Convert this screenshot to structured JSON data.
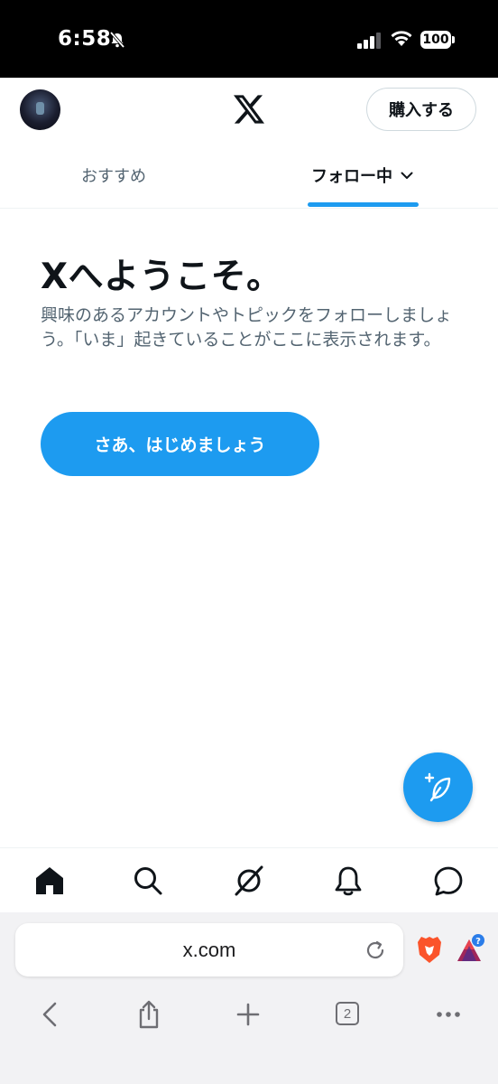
{
  "status_bar": {
    "time": "6:58",
    "battery": "100"
  },
  "header": {
    "logo": "x-logo",
    "subscribe_label": "購入する"
  },
  "tabs": [
    {
      "label": "おすすめ",
      "active": false
    },
    {
      "label": "フォロー中",
      "active": true
    }
  ],
  "welcome": {
    "title": "Xへようこそ。",
    "description": "興味のあるアカウントやトピックをフォローしましょう。「いま」起きていることがここに表示されます。",
    "button_label": "さあ、はじめましょう"
  },
  "bottom_nav": {
    "items": [
      "home-icon",
      "search-icon",
      "grok-icon",
      "bell-icon",
      "messages-icon"
    ]
  },
  "browser": {
    "url": "x.com",
    "tab_count": "2"
  },
  "colors": {
    "accent": "#1d9bf0",
    "text_primary": "#0f1419",
    "text_secondary": "#536471"
  }
}
